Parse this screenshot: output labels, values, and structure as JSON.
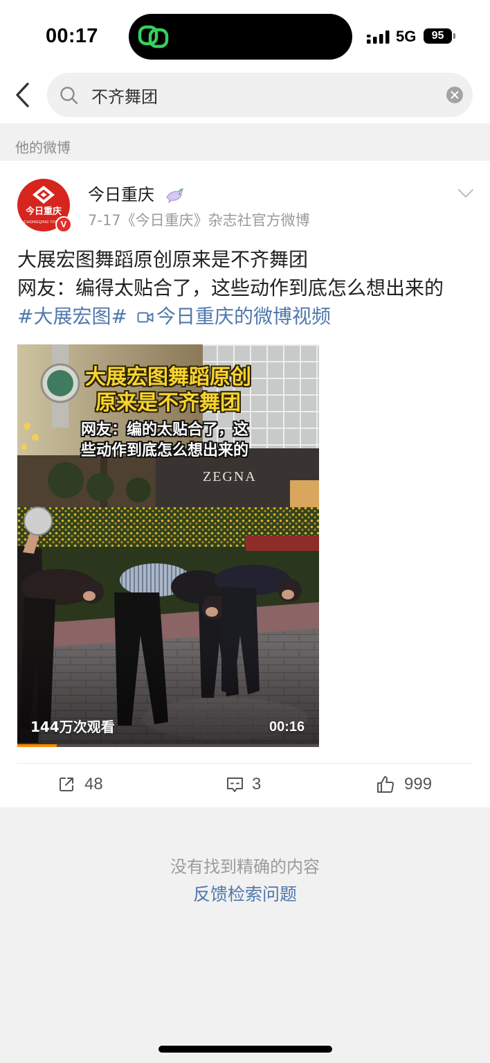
{
  "status_bar": {
    "time": "00:17",
    "network": "5G",
    "battery": "95"
  },
  "search": {
    "query": "不齐舞团"
  },
  "section": {
    "title": "他的微博"
  },
  "post": {
    "author": {
      "name": "今日重庆",
      "avatar_logo_text": "今日重庆",
      "avatar_logo_subtext": "CHONGQING TODAY",
      "verified_badge": "V"
    },
    "meta": "7-17《今日重庆》杂志社官方微博",
    "text_lines": [
      "大展宏图舞蹈原创原来是不齐舞团",
      "网友：编得太贴合了，这些动作到底怎么想出来的"
    ],
    "hashtag": "#大展宏图#",
    "video_link": "今日重庆的微博视频",
    "video": {
      "caption_title": [
        "大展宏图舞蹈原创",
        "原来是不齐舞团"
      ],
      "caption_subtitle": [
        "网友：编的太贴合了，这",
        "些动作到底怎么想出来的"
      ],
      "store_sign": "ZEGNA",
      "views": "144万次观看",
      "duration": "00:16",
      "progress": 0.13
    },
    "actions": {
      "reposts": "48",
      "comments": "3",
      "likes": "999"
    }
  },
  "empty_state": {
    "message": "没有找到精确的内容",
    "feedback_link": "反馈检索问题"
  },
  "colors": {
    "link": "#4f78ad",
    "avatar": "#d6251d",
    "progress": "#ff8a00",
    "caption": "#f8d52c",
    "panel": "#f1f1f1",
    "island_icon": "#35d05e"
  },
  "icons": {
    "island": "link-rings-icon",
    "back": "chevron-left-icon",
    "search": "search-icon",
    "clear": "clear-icon",
    "more": "chevron-down-icon",
    "member": "dove-badge-icon",
    "video": "video-camera-icon",
    "repost": "share-icon",
    "comment": "comment-icon",
    "like": "thumbs-up-icon"
  }
}
